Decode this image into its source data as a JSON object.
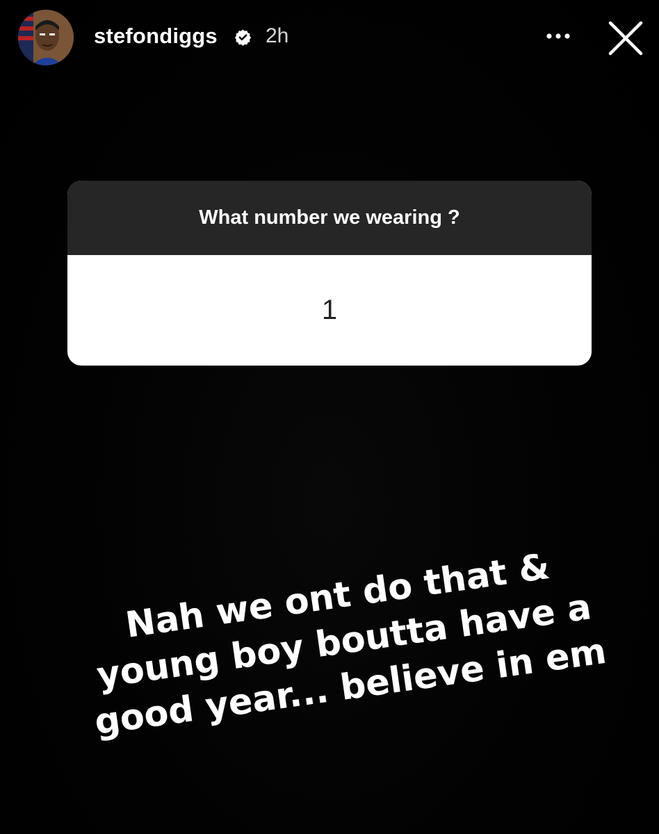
{
  "header": {
    "username": "stefondiggs",
    "time_ago": "2h",
    "verified_icon": "verified-badge-icon",
    "more_icon": "more-options-icon",
    "close_icon": "close-icon"
  },
  "question_sticker": {
    "question": "What number we wearing ?",
    "answer": "1"
  },
  "caption": {
    "lines": [
      "Nah we ont do that &",
      "young boy boutta have a",
      "good year... believe in em"
    ]
  },
  "colors": {
    "background": "#000000",
    "sticker_header": "#262626",
    "sticker_body": "#ffffff"
  }
}
